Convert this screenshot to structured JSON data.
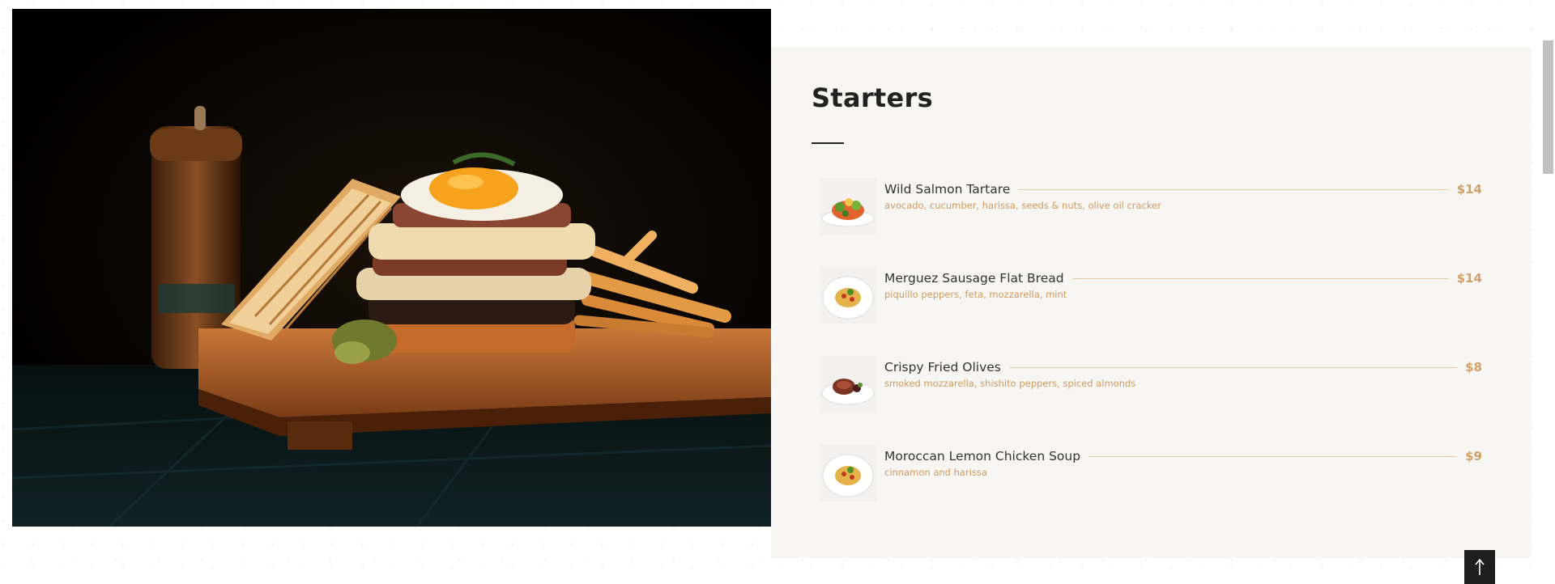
{
  "section": {
    "title": "Starters"
  },
  "menu": {
    "items": [
      {
        "name": "Wild Salmon Tartare",
        "price": "$14",
        "description": "avocado, cucumber, harissa, seeds & nuts, olive oil cracker",
        "thumb": "salad-plate"
      },
      {
        "name": "Merguez Sausage Flat Bread",
        "price": "$14",
        "description": "piquillo peppers, feta, mozzarella, mint",
        "thumb": "pasta-plate"
      },
      {
        "name": "Crispy Fried Olives",
        "price": "$8",
        "description": "smoked mozzarella, shishito peppers, spiced almonds",
        "thumb": "meat-plate"
      },
      {
        "name": "Moroccan Lemon Chicken Soup",
        "price": "$9",
        "description": "cinnamon and harissa",
        "thumb": "pasta-plate"
      }
    ]
  },
  "icons": {
    "back_to_top": "arrow-up-icon"
  },
  "colors": {
    "panel_bg": "#f7f6f3",
    "accent": "#d3a068",
    "title": "#222222",
    "back_to_top_bg": "#1e1e1e"
  }
}
